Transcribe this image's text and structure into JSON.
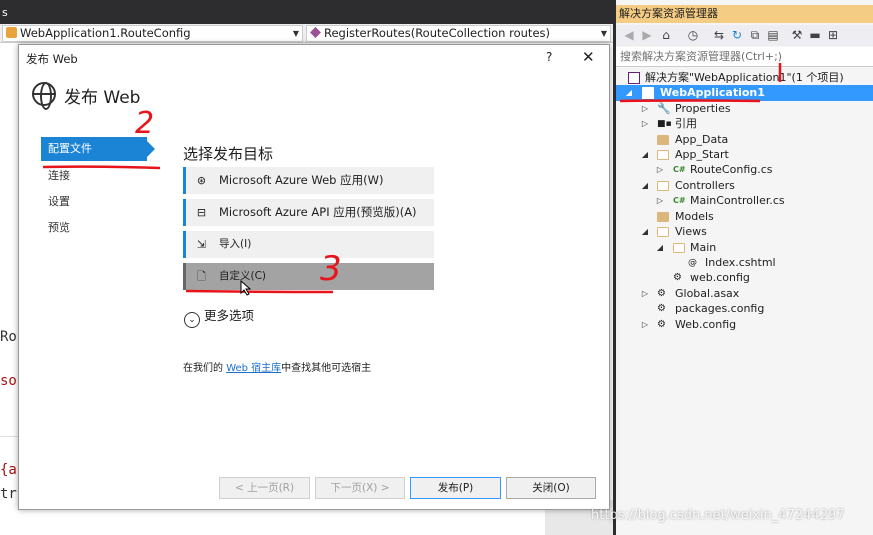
{
  "editor": {
    "tab_fragment": "s",
    "class_dropdown": "WebApplication1.RouteConfig",
    "method_dropdown": "RegisterRoutes(RouteCollection routes)",
    "code_fragments": [
      "Ro",
      "so",
      "{a",
      "tr"
    ]
  },
  "dialog": {
    "title": "发布 Web",
    "help": "?",
    "close": "✕",
    "heading": "发布 Web",
    "steps": [
      "配置文件",
      "连接",
      "设置",
      "预览"
    ],
    "main_heading": "选择发布目标",
    "targets": [
      {
        "label": "Microsoft Azure Web 应用(W)",
        "icon": "azure-icon"
      },
      {
        "label": "Microsoft Azure API 应用(预览版)(A)",
        "icon": "api-icon"
      },
      {
        "label": "导入(I)",
        "icon": "import-icon"
      },
      {
        "label": "自定义(C)",
        "icon": "document-icon"
      }
    ],
    "more_options": "更多选项",
    "host_prefix": "在我们的",
    "host_link": "Web 宿主库",
    "host_suffix": "中查找其他可选宿主",
    "buttons": {
      "prev": "< 上一页(R)",
      "next": "下一页(X) >",
      "publish": "发布(P)",
      "close": "关闭(O)"
    }
  },
  "solution_explorer": {
    "title": "解决方案资源管理器",
    "search_placeholder": "搜索解决方案资源管理器(Ctrl+;)",
    "items": [
      {
        "label": "解决方案\"WebApplication1\"(1 个项目)"
      },
      {
        "label": "WebApplication1"
      },
      {
        "label": "Properties"
      },
      {
        "label": "引用"
      },
      {
        "label": "App_Data"
      },
      {
        "label": "App_Start"
      },
      {
        "label": "RouteConfig.cs"
      },
      {
        "label": "Controllers"
      },
      {
        "label": "MainController.cs"
      },
      {
        "label": "Models"
      },
      {
        "label": "Views"
      },
      {
        "label": "Main"
      },
      {
        "label": "Index.cshtml"
      },
      {
        "label": "web.config"
      },
      {
        "label": "Global.asax"
      },
      {
        "label": "packages.config"
      },
      {
        "label": "Web.config"
      }
    ]
  },
  "annotations": [
    "2",
    "3"
  ],
  "watermark": "https://blog.csdn.net/weixin_47244297",
  "colors": {
    "accent": "#1c84d4",
    "selection": "#3399ff",
    "title_tab": "#f5cc84",
    "annotation": "#e8141b"
  }
}
